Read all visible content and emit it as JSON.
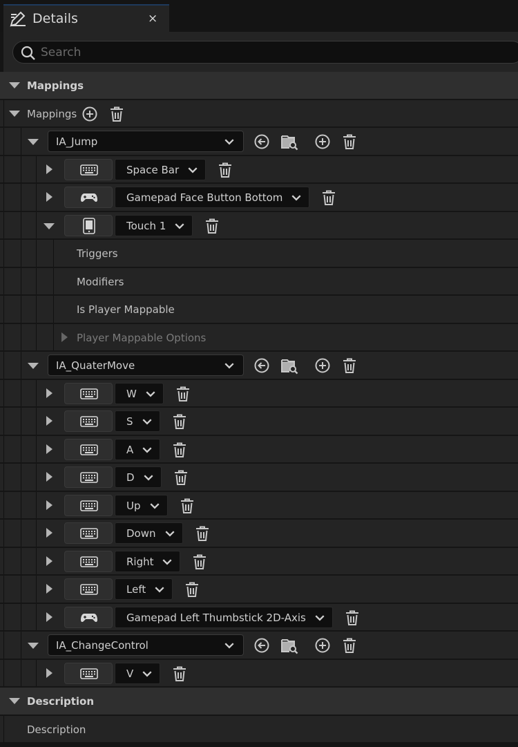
{
  "tab": {
    "title": "Details",
    "close": "×"
  },
  "search": {
    "placeholder": "Search",
    "value": ""
  },
  "sections": {
    "mappings_category": "Mappings",
    "mappings_array": "Mappings",
    "description_category": "Description",
    "description_field": "Description"
  },
  "actions": [
    {
      "name": "IA_Jump",
      "keys": [
        {
          "label": "Space Bar",
          "device": "keyboard-icon",
          "expanded": false
        },
        {
          "label": "Gamepad Face Button Bottom",
          "device": "gamepad-icon",
          "expanded": false
        },
        {
          "label": "Touch 1",
          "device": "phone-icon",
          "expanded": true
        }
      ],
      "subprops": [
        "Triggers",
        "Modifiers",
        "Is Player Mappable",
        "Player Mappable Options"
      ]
    },
    {
      "name": "IA_QuaterMove",
      "keys": [
        {
          "label": "W",
          "device": "keyboard-icon"
        },
        {
          "label": "S",
          "device": "keyboard-icon"
        },
        {
          "label": "A",
          "device": "keyboard-icon"
        },
        {
          "label": "D",
          "device": "keyboard-icon"
        },
        {
          "label": "Up",
          "device": "keyboard-icon"
        },
        {
          "label": "Down",
          "device": "keyboard-icon"
        },
        {
          "label": "Right",
          "device": "keyboard-icon"
        },
        {
          "label": "Left",
          "device": "keyboard-icon"
        },
        {
          "label": "Gamepad Left Thumbstick 2D-Axis",
          "device": "gamepad-icon"
        }
      ]
    },
    {
      "name": "IA_ChangeControl",
      "keys": [
        {
          "label": "V",
          "device": "keyboard-icon"
        }
      ]
    }
  ],
  "colors": {
    "panel": "#242424",
    "field": "#0f0f0f",
    "row_alt": "#1e1e1e",
    "text": "#c0c0c0"
  }
}
